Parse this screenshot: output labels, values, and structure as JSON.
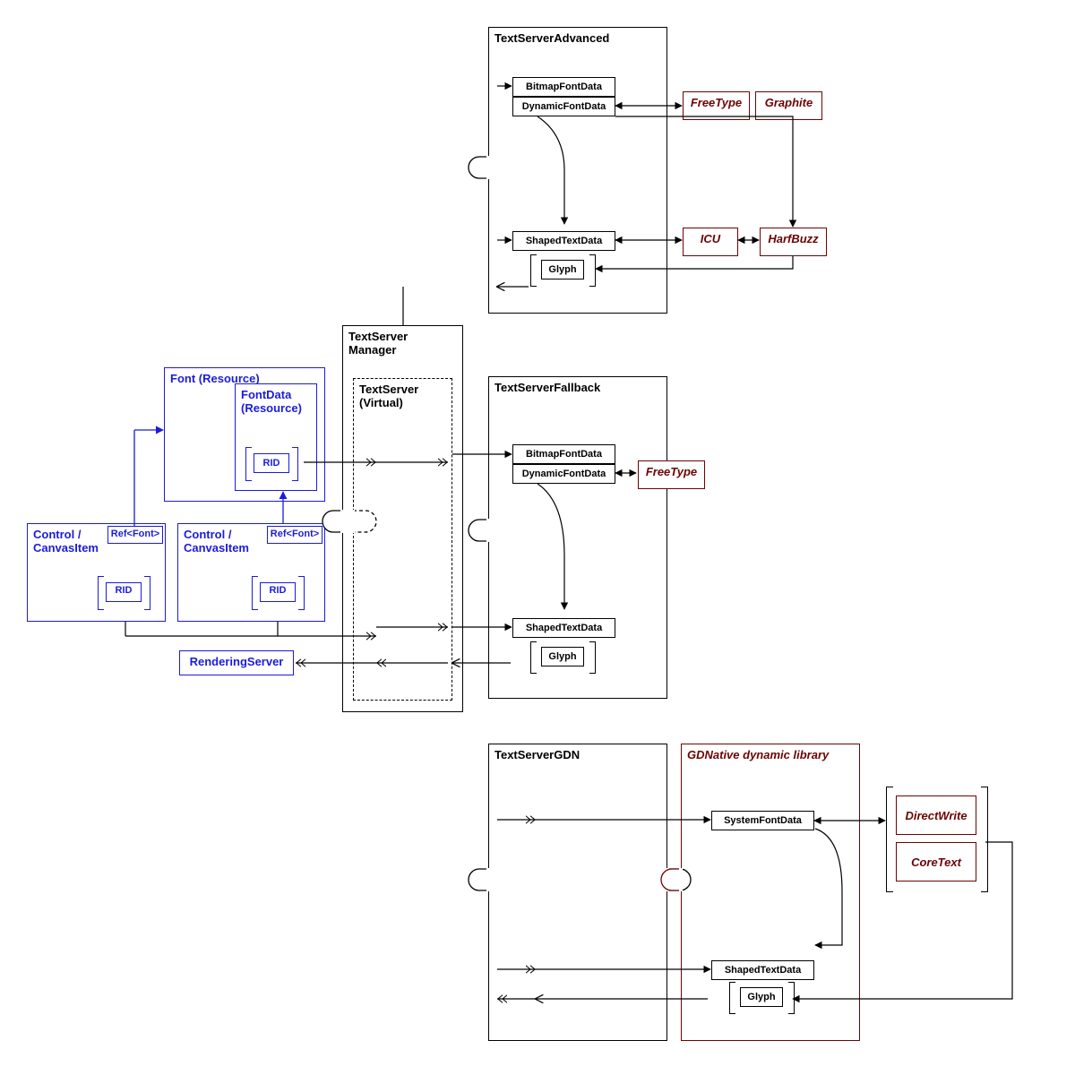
{
  "title_advanced": "TextServerAdvanced",
  "title_fallback": "TextServerFallback",
  "title_gdn": "TextServerGDN",
  "title_manager": "TextServer Manager",
  "title_virtual": "TextServer (Virtual)",
  "font_resource": "Font (Resource)",
  "fontdata_resource": "FontData (Resource)",
  "rid": "RID",
  "control_canvas": "Control / CanvasItem",
  "ref_font": "Ref<Font>",
  "rendering_server": "RenderingServer",
  "bitmap": "BitmapFontData",
  "dynamic": "DynamicFontData",
  "shaped": "ShapedTextData",
  "glyph": "Glyph",
  "freetype": "FreeType",
  "graphite": "Graphite",
  "icu": "ICU",
  "harfbuzz": "HarfBuzz",
  "system_font": "SystemFontData",
  "gdn_lib": "GDNative dynamic library",
  "directwrite": "DirectWrite",
  "coretext": "CoreText"
}
